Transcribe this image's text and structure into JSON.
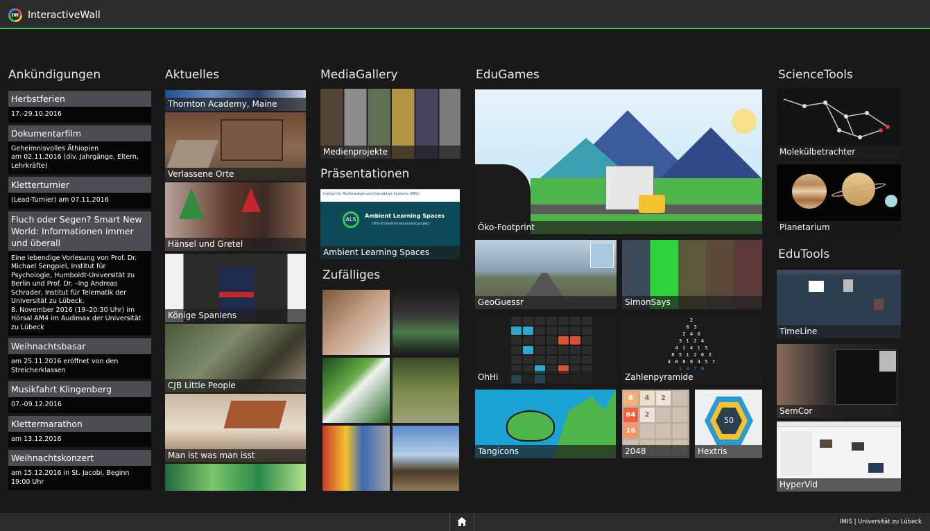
{
  "app": {
    "title": "InteractiveWall",
    "logo_text": "IW"
  },
  "columns": {
    "announcements": "Ankündigungen",
    "news": "Aktuelles",
    "media": "MediaGallery",
    "presentations": "Präsentationen",
    "random": "Zufälliges",
    "edugames": "EduGames",
    "sciencetools": "ScienceTools",
    "edutools": "EduTools"
  },
  "announcements": [
    {
      "title": "Herbstferien",
      "body": "17.-29.10.2016"
    },
    {
      "title": "Dokumentarfilm",
      "body": "Geheimnisvolles Äthiopien\nam 02.11.2016 (div. Jahrgänge, Eltern, Lehrkräfte)"
    },
    {
      "title": "Kletterturnier",
      "body": "(Lead-Turnier) am 07.11.2016"
    },
    {
      "title": "Fluch oder Segen? Smart New World: Informationen immer und überall",
      "body": "Eine lebendige Vorlesung von Prof. Dr. Michael Sengpiel, Institut für Psychologie, Humboldt-Universität zu Berlin und Prof. Dr. –Ing Andreas Schrader, Institut für Telematik der Universität zu Lübeck.\n8. November 2016 (19–20:30 Uhr) im Hörsal AM4 im Audimax der Universität zu Lübeck"
    },
    {
      "title": "Weihnachtsbasar",
      "body": "am 25.11.2016 eröffnet von den Streicherklassen"
    },
    {
      "title": "Musikfahrt Klingenberg",
      "body": "07.-09.12.2016"
    },
    {
      "title": "Klettermarathon",
      "body": "am 13.12.2016"
    },
    {
      "title": "Weihnachtskonzert",
      "body": "am 15.12.2016 in St. Jacobi, Beginn 19:00 Uhr"
    }
  ],
  "news": [
    "Thornton Academy, Maine",
    "Verlassene Orte",
    "Hänsel und Gretel",
    "Könige Spaniens",
    "CJB Little People",
    "Man ist was man isst"
  ],
  "media": {
    "projects": "Medienprojekte",
    "presentation": "Ambient Learning Spaces",
    "slide_institute": "Institut für Multimediale und Interaktive Systeme (IMIS)",
    "slide_title": "Ambient Learning Spaces",
    "slide_sub": "DFG-Erkenntnistransferprojekt",
    "slide_badge": "ALS"
  },
  "games": {
    "oeko": "Öko-Footprint",
    "geo": "GeoGuessr",
    "simon": "SimonSays",
    "ohhi": "OhHi",
    "zahlen": "Zahlenpyramide",
    "tangicons": "Tangicons",
    "g2048": "2048",
    "hextris": "Hextris",
    "hextris_score": "50"
  },
  "pyramid_rows": [
    "2",
    "6 3",
    "2 4 6",
    "3 1 2 4",
    "4 1 4 1 5",
    "8 5 1 2 6 2",
    "4 8 8 8 4 5 7",
    "1 3 7 6"
  ],
  "board2048": [
    "8",
    "4",
    "2",
    "",
    "64",
    "2",
    "",
    "",
    "16",
    "",
    "",
    "",
    "",
    "",
    "",
    ""
  ],
  "science": {
    "molekuel": "Molekülbetrachter",
    "planetarium": "Planetarium"
  },
  "edutools": {
    "timeline": "TimeLine",
    "semcor": "SemCor",
    "hypervid": "HyperVid"
  },
  "footer": {
    "credit": "IMIS | Universität zu Lübeck"
  },
  "colors": {
    "accent": "#3ec74b",
    "header": "#2b2b2b",
    "background": "#191919"
  }
}
